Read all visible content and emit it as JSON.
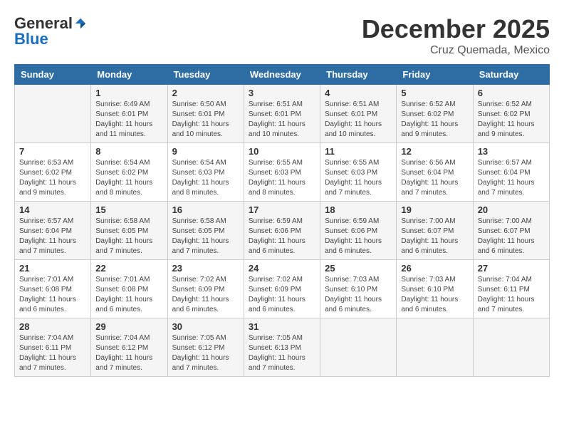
{
  "header": {
    "logo_general": "General",
    "logo_blue": "Blue",
    "month_title": "December 2025",
    "location": "Cruz Quemada, Mexico"
  },
  "days_of_week": [
    "Sunday",
    "Monday",
    "Tuesday",
    "Wednesday",
    "Thursday",
    "Friday",
    "Saturday"
  ],
  "weeks": [
    [
      {
        "day": "",
        "info": ""
      },
      {
        "day": "1",
        "info": "Sunrise: 6:49 AM\nSunset: 6:01 PM\nDaylight: 11 hours\nand 11 minutes."
      },
      {
        "day": "2",
        "info": "Sunrise: 6:50 AM\nSunset: 6:01 PM\nDaylight: 11 hours\nand 10 minutes."
      },
      {
        "day": "3",
        "info": "Sunrise: 6:51 AM\nSunset: 6:01 PM\nDaylight: 11 hours\nand 10 minutes."
      },
      {
        "day": "4",
        "info": "Sunrise: 6:51 AM\nSunset: 6:01 PM\nDaylight: 11 hours\nand 10 minutes."
      },
      {
        "day": "5",
        "info": "Sunrise: 6:52 AM\nSunset: 6:02 PM\nDaylight: 11 hours\nand 9 minutes."
      },
      {
        "day": "6",
        "info": "Sunrise: 6:52 AM\nSunset: 6:02 PM\nDaylight: 11 hours\nand 9 minutes."
      }
    ],
    [
      {
        "day": "7",
        "info": "Sunrise: 6:53 AM\nSunset: 6:02 PM\nDaylight: 11 hours\nand 9 minutes."
      },
      {
        "day": "8",
        "info": "Sunrise: 6:54 AM\nSunset: 6:02 PM\nDaylight: 11 hours\nand 8 minutes."
      },
      {
        "day": "9",
        "info": "Sunrise: 6:54 AM\nSunset: 6:03 PM\nDaylight: 11 hours\nand 8 minutes."
      },
      {
        "day": "10",
        "info": "Sunrise: 6:55 AM\nSunset: 6:03 PM\nDaylight: 11 hours\nand 8 minutes."
      },
      {
        "day": "11",
        "info": "Sunrise: 6:55 AM\nSunset: 6:03 PM\nDaylight: 11 hours\nand 7 minutes."
      },
      {
        "day": "12",
        "info": "Sunrise: 6:56 AM\nSunset: 6:04 PM\nDaylight: 11 hours\nand 7 minutes."
      },
      {
        "day": "13",
        "info": "Sunrise: 6:57 AM\nSunset: 6:04 PM\nDaylight: 11 hours\nand 7 minutes."
      }
    ],
    [
      {
        "day": "14",
        "info": "Sunrise: 6:57 AM\nSunset: 6:04 PM\nDaylight: 11 hours\nand 7 minutes."
      },
      {
        "day": "15",
        "info": "Sunrise: 6:58 AM\nSunset: 6:05 PM\nDaylight: 11 hours\nand 7 minutes."
      },
      {
        "day": "16",
        "info": "Sunrise: 6:58 AM\nSunset: 6:05 PM\nDaylight: 11 hours\nand 7 minutes."
      },
      {
        "day": "17",
        "info": "Sunrise: 6:59 AM\nSunset: 6:06 PM\nDaylight: 11 hours\nand 6 minutes."
      },
      {
        "day": "18",
        "info": "Sunrise: 6:59 AM\nSunset: 6:06 PM\nDaylight: 11 hours\nand 6 minutes."
      },
      {
        "day": "19",
        "info": "Sunrise: 7:00 AM\nSunset: 6:07 PM\nDaylight: 11 hours\nand 6 minutes."
      },
      {
        "day": "20",
        "info": "Sunrise: 7:00 AM\nSunset: 6:07 PM\nDaylight: 11 hours\nand 6 minutes."
      }
    ],
    [
      {
        "day": "21",
        "info": "Sunrise: 7:01 AM\nSunset: 6:08 PM\nDaylight: 11 hours\nand 6 minutes."
      },
      {
        "day": "22",
        "info": "Sunrise: 7:01 AM\nSunset: 6:08 PM\nDaylight: 11 hours\nand 6 minutes."
      },
      {
        "day": "23",
        "info": "Sunrise: 7:02 AM\nSunset: 6:09 PM\nDaylight: 11 hours\nand 6 minutes."
      },
      {
        "day": "24",
        "info": "Sunrise: 7:02 AM\nSunset: 6:09 PM\nDaylight: 11 hours\nand 6 minutes."
      },
      {
        "day": "25",
        "info": "Sunrise: 7:03 AM\nSunset: 6:10 PM\nDaylight: 11 hours\nand 6 minutes."
      },
      {
        "day": "26",
        "info": "Sunrise: 7:03 AM\nSunset: 6:10 PM\nDaylight: 11 hours\nand 6 minutes."
      },
      {
        "day": "27",
        "info": "Sunrise: 7:04 AM\nSunset: 6:11 PM\nDaylight: 11 hours\nand 7 minutes."
      }
    ],
    [
      {
        "day": "28",
        "info": "Sunrise: 7:04 AM\nSunset: 6:11 PM\nDaylight: 11 hours\nand 7 minutes."
      },
      {
        "day": "29",
        "info": "Sunrise: 7:04 AM\nSunset: 6:12 PM\nDaylight: 11 hours\nand 7 minutes."
      },
      {
        "day": "30",
        "info": "Sunrise: 7:05 AM\nSunset: 6:12 PM\nDaylight: 11 hours\nand 7 minutes."
      },
      {
        "day": "31",
        "info": "Sunrise: 7:05 AM\nSunset: 6:13 PM\nDaylight: 11 hours\nand 7 minutes."
      },
      {
        "day": "",
        "info": ""
      },
      {
        "day": "",
        "info": ""
      },
      {
        "day": "",
        "info": ""
      }
    ]
  ]
}
